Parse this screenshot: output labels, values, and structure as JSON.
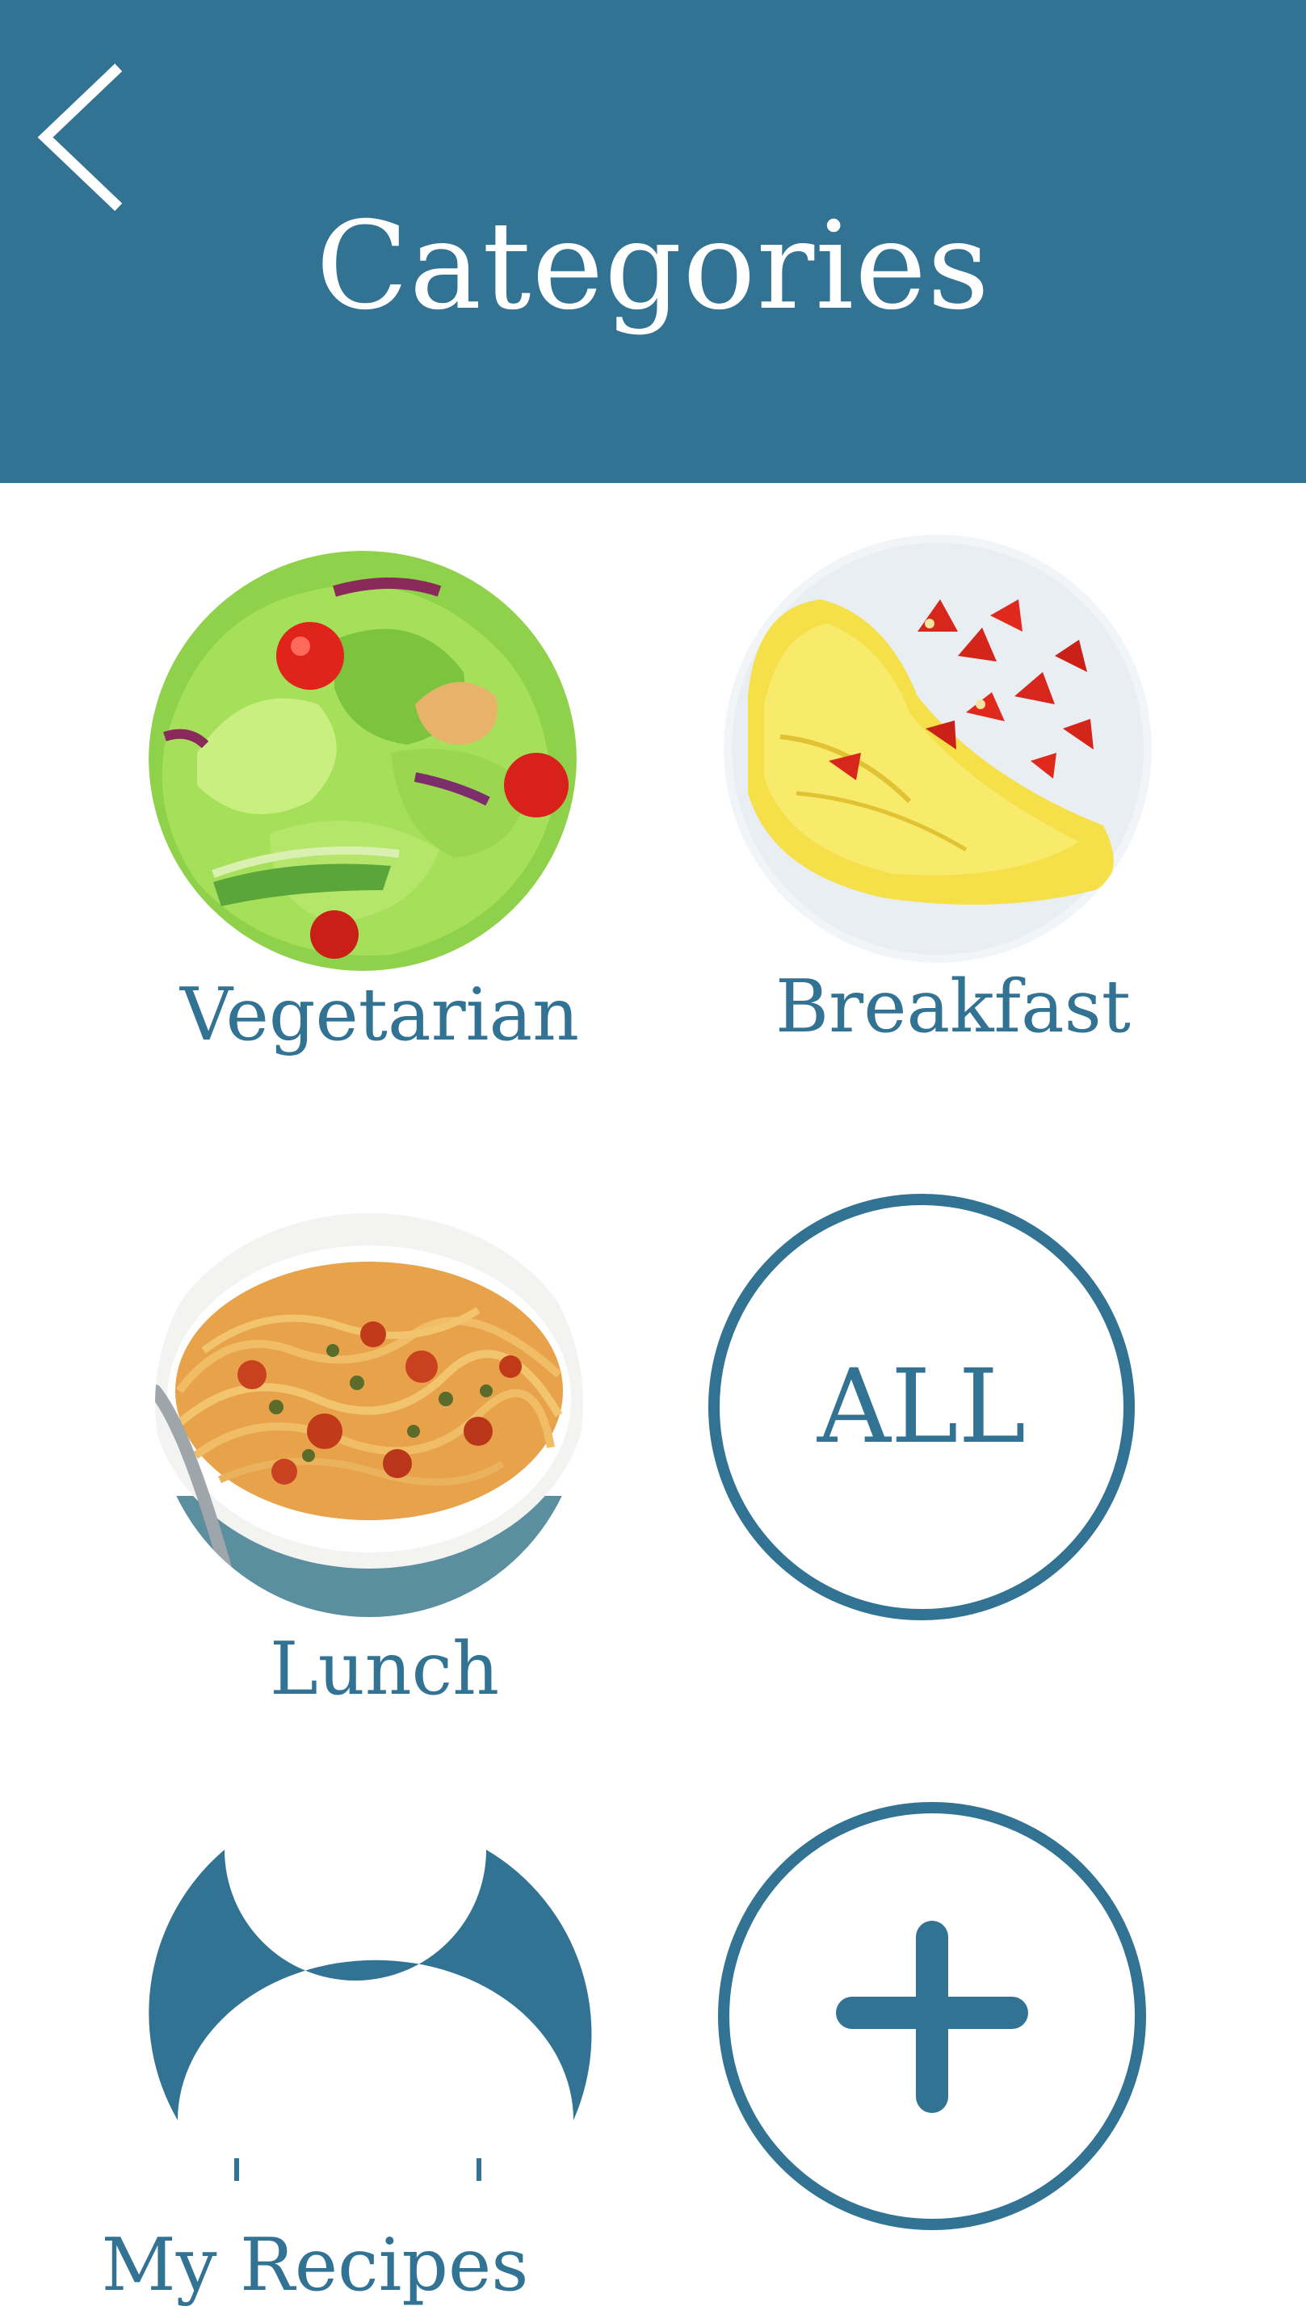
{
  "header": {
    "title": "Categories",
    "back_icon": "chevron-left-icon"
  },
  "categories": [
    {
      "label": "Vegetarian",
      "image": "salad"
    },
    {
      "label": "Breakfast",
      "image": "omelette-with-tomatoes"
    },
    {
      "label": "Lunch",
      "image": "spaghetti-with-tomato-sauce"
    },
    {
      "label": "ALL"
    },
    {
      "label": "My Recipes",
      "icon": "chef-hat-icon"
    },
    {
      "icon": "plus-icon"
    }
  ],
  "colors": {
    "primary": "#327293",
    "background": "#ffffff"
  }
}
